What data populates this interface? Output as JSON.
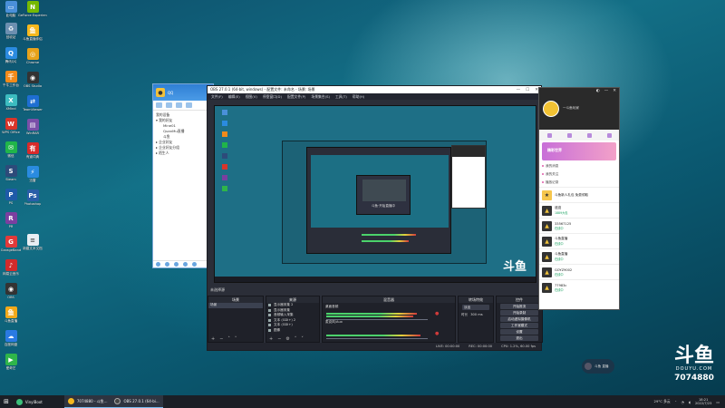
{
  "desktop": {
    "icons_col1": [
      {
        "label": "此电脑",
        "color": "#4a90d9"
      },
      {
        "label": "回收站",
        "color": "#6c8fb0"
      },
      {
        "label": "腾讯QQ",
        "color": "#2b8be0"
      },
      {
        "label": "千牛工作台",
        "color": "#f28a1a"
      },
      {
        "label": "XMind",
        "color": "#3cbcc0"
      },
      {
        "label": "WPS Office",
        "color": "#d8352a"
      },
      {
        "label": "微信",
        "color": "#20b54a"
      },
      {
        "label": "Steam",
        "color": "#2d4b7a"
      },
      {
        "label": "PS",
        "color": "#1e5aa8"
      },
      {
        "label": "PR",
        "color": "#7b3fa0"
      },
      {
        "label": "GarageBand",
        "color": "#e23a3a"
      },
      {
        "label": "网易云音乐",
        "color": "#d22b2b"
      },
      {
        "label": "OBS",
        "color": "#333"
      },
      {
        "label": "斗鱼直播",
        "color": "#f2a91a"
      },
      {
        "label": "百度网盘",
        "color": "#2a7ae2"
      },
      {
        "label": "爱奇艺",
        "color": "#2fb54a"
      }
    ],
    "icons_col2": [
      {
        "label": "GeForce Experience",
        "color": "#76b900"
      },
      {
        "label": "斗鱼直播伴侣",
        "color": "#f5b81e"
      },
      {
        "label": "Chrome",
        "color": "#e8a21a"
      },
      {
        "label": "OBS Studio",
        "color": "#333"
      },
      {
        "label": "TeamViewer",
        "color": "#1e6ed2"
      },
      {
        "label": "WinRAR",
        "color": "#7a4fa8"
      },
      {
        "label": "有道词典",
        "color": "#d82a2a"
      },
      {
        "label": "迅雷",
        "color": "#2a8be0"
      },
      {
        "label": "Photoshop",
        "color": "#2a5ea8"
      },
      {
        "label": "新建文本文档",
        "color": "#e9eef3"
      }
    ]
  },
  "qq": {
    "title": "QQ",
    "rows": [
      {
        "text": "我的设备",
        "sub": false
      },
      {
        "text": "▾ 我的好友",
        "sub": false
      },
      {
        "text": "Mine01",
        "sub": true
      },
      {
        "text": "QuanMu直播",
        "sub": true
      },
      {
        "text": "斗鱼",
        "sub": true
      },
      {
        "text": "▸ 企业好友",
        "sub": false
      },
      {
        "text": "▸ 企业好友分组",
        "sub": false
      },
      {
        "text": "▸ 陌生人",
        "sub": false
      }
    ]
  },
  "obs": {
    "title": "OBS 27.0.1 (64-bit, windows) - 配置文件: 未命名 - 场景: 场景",
    "menu": [
      "文件(F)",
      "编辑(E)",
      "视图(V)",
      "停靠窗口(D)",
      "配置文件(P)",
      "场景集合(S)",
      "工具(T)",
      "帮助(H)"
    ],
    "scene_label": "未选择源",
    "docks": {
      "scenes": {
        "title": "场景",
        "items": [
          "场景"
        ]
      },
      "sources": {
        "title": "来源",
        "items": [
          "显示器采集 2",
          "显示器采集",
          "音频输入采集",
          "文本 (GDI+) 2",
          "文本 (GDI+)",
          "图像"
        ]
      },
      "mixer": {
        "title": "混音器",
        "channels": [
          "桌面音频",
          "麦克风/Aux"
        ]
      },
      "transitions": {
        "title": "转场特效",
        "type": "淡出",
        "duration_label": "时长",
        "duration": "300 ms"
      },
      "controls": {
        "title": "控件",
        "buttons": [
          "开始推流",
          "开始录制",
          "启动虚拟摄像机",
          "工作室模式",
          "设置",
          "退出"
        ]
      }
    },
    "status": [
      "LIVE: 00:00:00",
      "REC: 00:00:00",
      "CPU: 1.2%, 60.00 fps"
    ],
    "nested_caption": "斗鱼·开始直播中"
  },
  "douyu": {
    "user": "一斗鱼玩家",
    "banner": "精彩世界",
    "links": [
      "我的消息",
      "我的关注",
      "播放记录"
    ],
    "promo": "斗鱼新人礼包 免费领取",
    "rooms": [
      {
        "name": "遗迹",
        "meta": "1889大包"
      },
      {
        "name": "33567125",
        "meta": "在线中"
      },
      {
        "name": "斗鱼直播",
        "meta": "在线中"
      },
      {
        "name": "斗鱼直播",
        "meta": "在线中"
      },
      {
        "name": "GOYZ9002",
        "meta": "在线中"
      },
      {
        "name": "77983c",
        "meta": "在线中"
      }
    ]
  },
  "taskbar": {
    "tasks": [
      {
        "label": "VinylBoot",
        "color": "#3cbf7a"
      },
      {
        "label": "7074880 - 斗鱼...",
        "color": "#f5b81e"
      },
      {
        "label": "OBS 27.0.1 (64-bi...",
        "color": "#444"
      }
    ],
    "tray_weather": "29°C 多云",
    "time": "18:21",
    "date": "2022/7/23"
  },
  "watermark": {
    "logo": "斗鱼",
    "brand": "DOUYU.COM",
    "room_number": "7074880"
  },
  "chip": {
    "text": "斗鱼 直播"
  }
}
